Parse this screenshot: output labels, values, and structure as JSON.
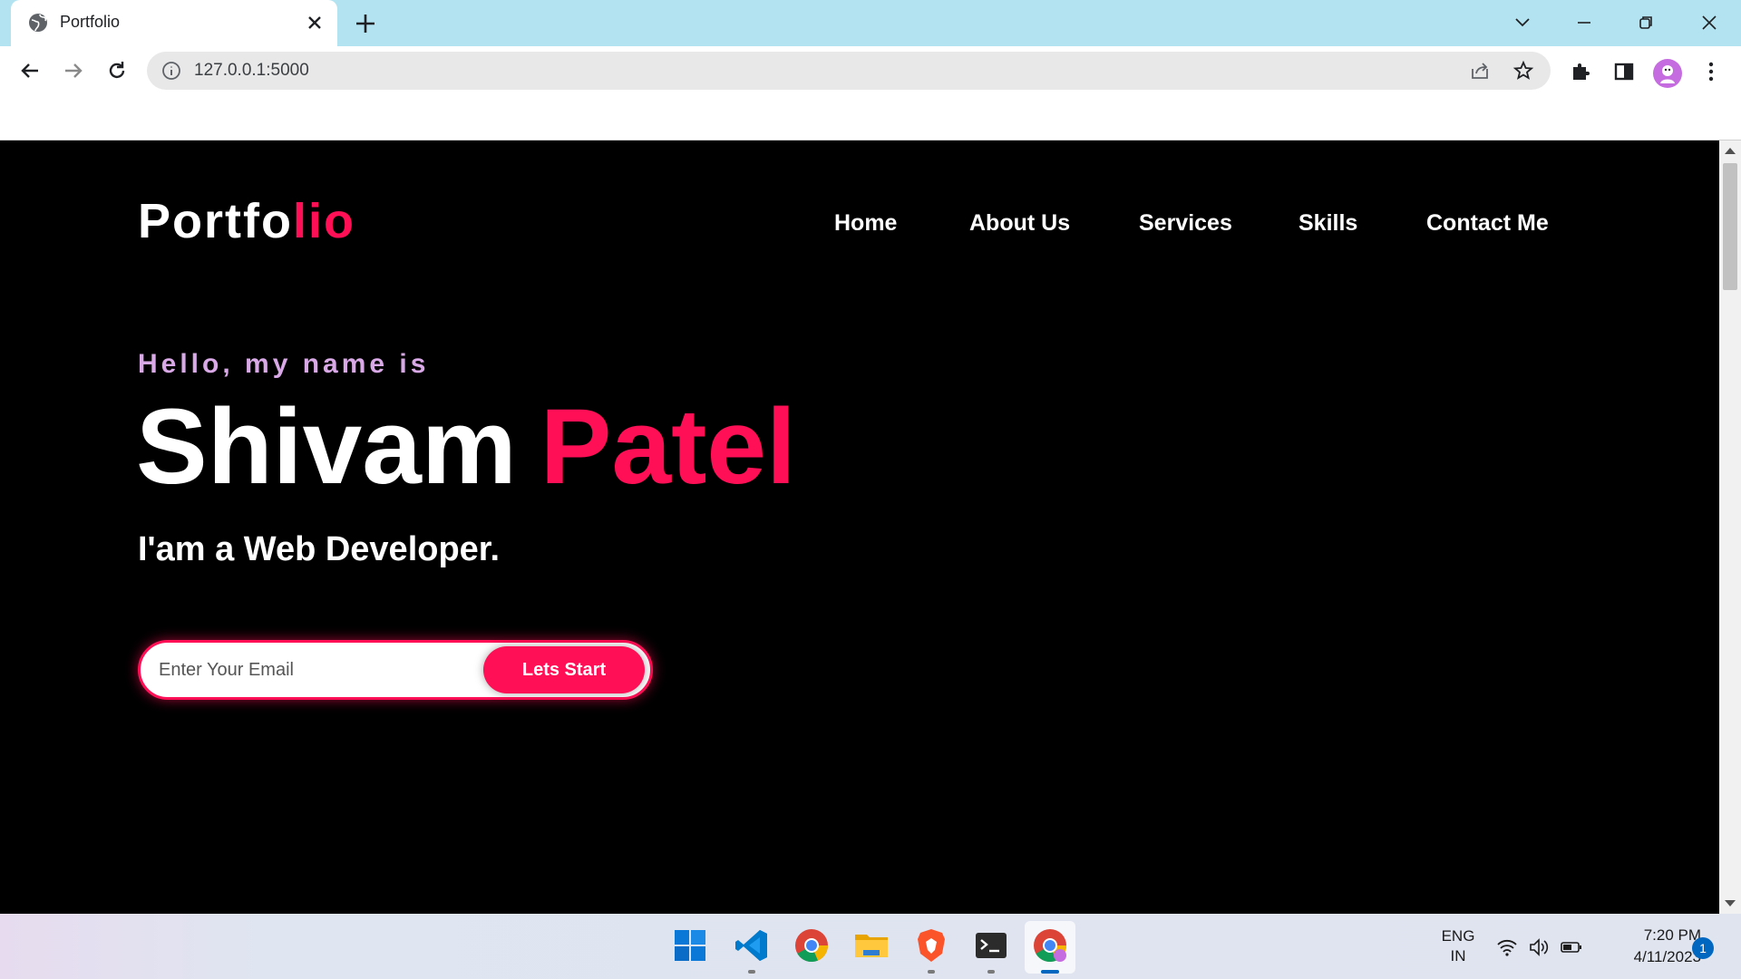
{
  "browser": {
    "tab": {
      "title": "Portfolio",
      "favicon": "globe-icon"
    },
    "url": "127.0.0.1:5000",
    "nav_icons": [
      "back-arrow-icon",
      "forward-arrow-icon",
      "reload-icon"
    ],
    "omnibox_icons": [
      "info-icon",
      "share-icon",
      "bookmark-star-icon"
    ],
    "toolbar_icons": [
      "extensions-puzzle-icon",
      "side-panel-icon",
      "profile-avatar",
      "menu-kebab-icon"
    ],
    "window_controls": [
      "tab-search-chevron-icon",
      "minimize-icon",
      "restore-icon",
      "close-icon"
    ]
  },
  "page": {
    "logo": {
      "main": "Portfo",
      "accent": "lio"
    },
    "nav": [
      {
        "label": "Home"
      },
      {
        "label": "About Us"
      },
      {
        "label": "Services"
      },
      {
        "label": "Skills"
      },
      {
        "label": "Contact Me"
      }
    ],
    "hero": {
      "greeting": "Hello, my name is",
      "first_name": "Shivam",
      "last_name": "Patel",
      "role": "I'am a Web Developer."
    },
    "form": {
      "email_placeholder": "Enter Your Email",
      "email_value": "",
      "button_label": "Lets Start"
    },
    "colors": {
      "accent": "#ff0f55",
      "greeting": "#d9a8e6",
      "background": "#000000"
    }
  },
  "taskbar": {
    "apps": [
      "windows-start-icon",
      "vscode-icon",
      "chrome-icon",
      "file-explorer-icon",
      "brave-icon",
      "terminal-icon",
      "chrome-profile-icon"
    ],
    "language": {
      "line1": "ENG",
      "line2": "IN"
    },
    "tray_icons": [
      "wifi-icon",
      "volume-icon",
      "battery-icon"
    ],
    "time": "7:20 PM",
    "date": "4/11/2023",
    "notification_count": "1"
  }
}
